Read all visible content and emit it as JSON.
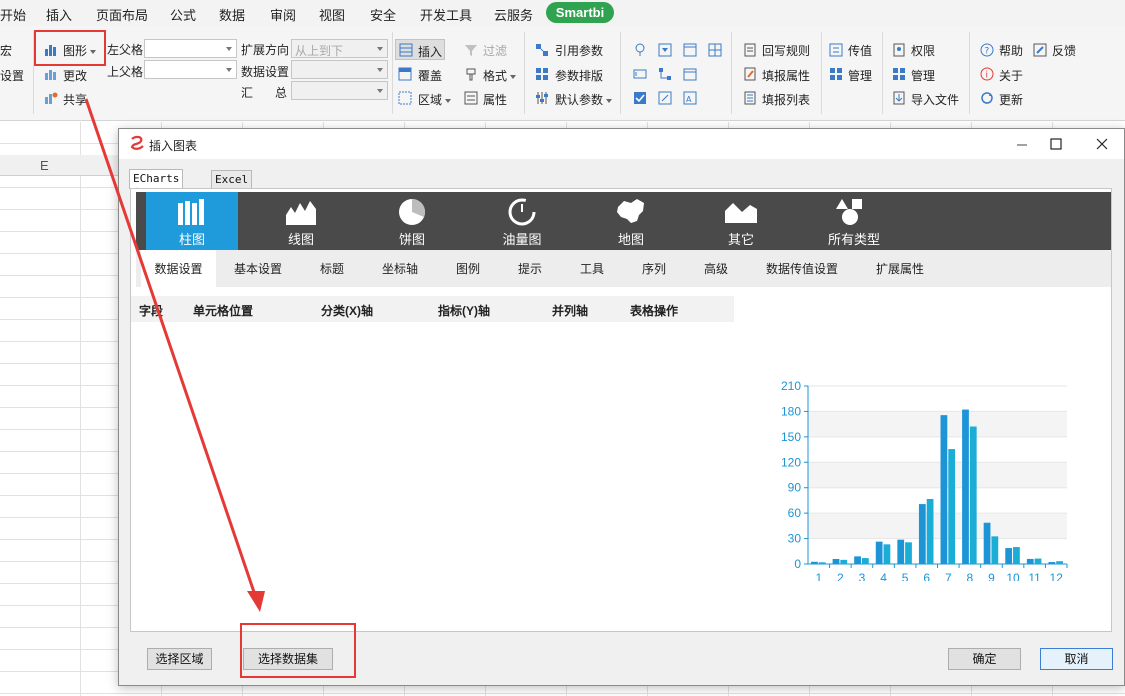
{
  "menubar": {
    "items": [
      "开始",
      "插入",
      "页面布局",
      "公式",
      "数据",
      "审阅",
      "视图",
      "安全",
      "开发工具",
      "云服务"
    ],
    "smartbi": "Smartbi"
  },
  "ribbon": {
    "col0": [
      "宏",
      "设置"
    ],
    "chart_group": {
      "chart": "图形",
      "change": "更改",
      "share": "共享"
    },
    "parent": {
      "left": "左父格",
      "up": "上父格"
    },
    "expand": {
      "dir_label": "扩展方向",
      "dir_value": "从上到下",
      "data_label": "数据设置",
      "sum_label_1": "汇",
      "sum_label_2": "总"
    },
    "insert_group": {
      "insert": "插入",
      "cover": "覆盖",
      "region": "区域",
      "filter": "过滤",
      "format": "格式",
      "property": "属性"
    },
    "param_group": {
      "ref": "引用参数",
      "layout": "参数排版",
      "default": "默认参数"
    },
    "fill_group": {
      "rule": "回写规则",
      "attr": "填报属性",
      "list": "填报列表"
    },
    "pass_group": {
      "pass": "传值",
      "manage": "管理"
    },
    "perm_group": {
      "perm": "权限",
      "manage": "管理",
      "import": "导入文件"
    },
    "help_group": {
      "help": "帮助",
      "feedback": "反馈",
      "about": "关于",
      "update": "更新"
    }
  },
  "sheet": {
    "col_e": "E"
  },
  "dialog": {
    "title": "插入图表",
    "tabs": [
      "ECharts作图",
      "Excel作图"
    ],
    "chart_types": [
      "柱图",
      "线图",
      "饼图",
      "油量图",
      "地图",
      "其它",
      "所有类型"
    ],
    "subtabs": [
      "数据设置",
      "基本设置",
      "标题",
      "坐标轴",
      "图例",
      "提示",
      "工具",
      "序列",
      "高级",
      "数据传值设置",
      "扩展属性"
    ],
    "grid_headers": [
      "字段",
      "单元格位置",
      "分类(X)轴",
      "指标(Y)轴",
      "并列轴",
      "表格操作"
    ],
    "buttons": {
      "select_region": "选择区域",
      "select_dataset": "选择数据集",
      "ok": "确定",
      "cancel": "取消"
    }
  },
  "chart_data": {
    "type": "bar",
    "categories": [
      "1",
      "2",
      "3",
      "4",
      "5",
      "6",
      "7",
      "8",
      "9",
      "10",
      "11",
      "12"
    ],
    "series": [
      {
        "values": [
          2.6,
          5.9,
          9.0,
          26.4,
          28.7,
          70.7,
          175.6,
          182.2,
          48.7,
          18.8,
          6.0,
          2.3
        ]
      },
      {
        "values": [
          2.0,
          4.9,
          7.0,
          23.2,
          25.6,
          76.7,
          135.6,
          162.2,
          32.6,
          20.0,
          6.4,
          3.3
        ]
      }
    ],
    "y_ticks": [
      "0",
      "30",
      "60",
      "90",
      "120",
      "150",
      "180",
      "210"
    ],
    "ylim": [
      0,
      210
    ],
    "colors": [
      "#1d94d6",
      "#1aadd6"
    ],
    "grid": true
  }
}
